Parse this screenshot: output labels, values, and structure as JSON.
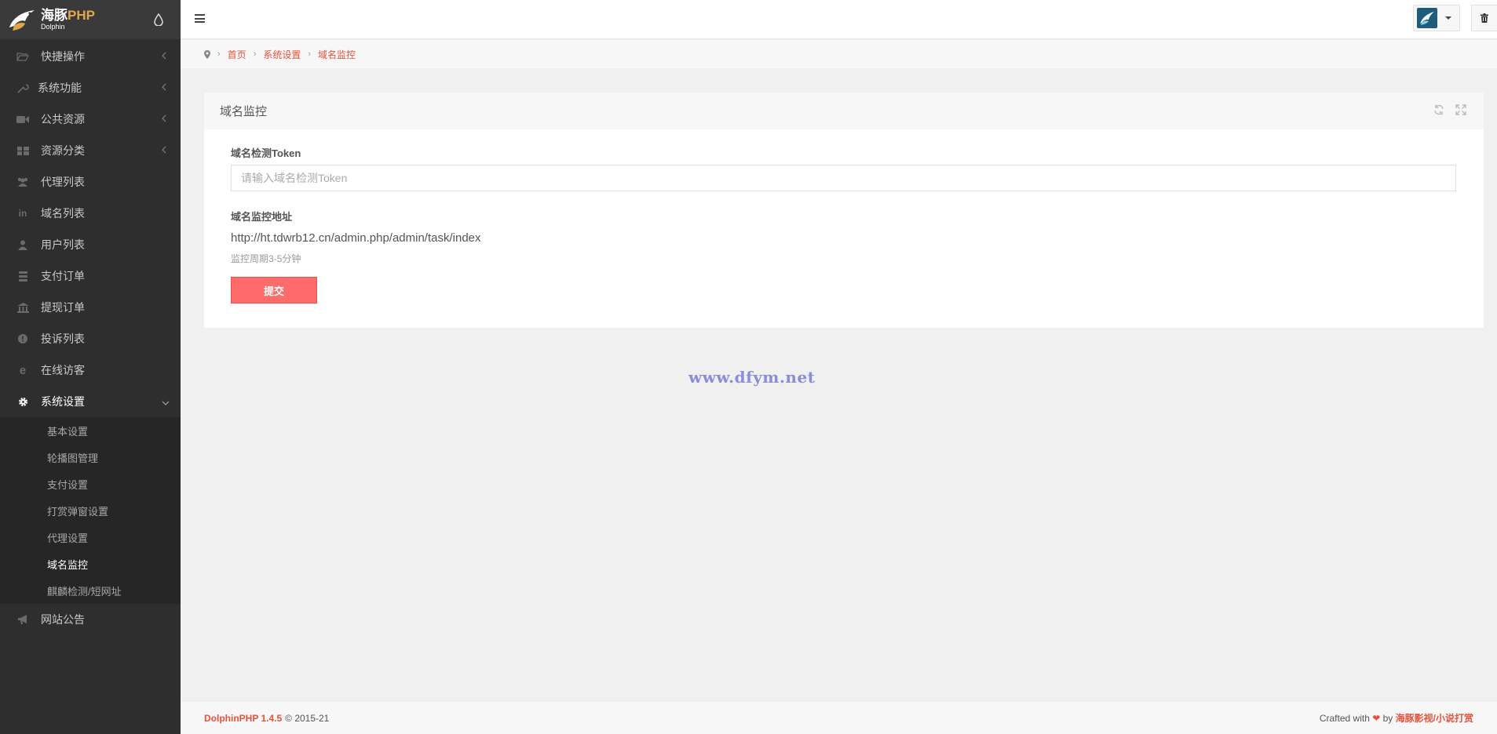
{
  "logo": {
    "name_cn": "海豚",
    "name_php": "PHP",
    "sub": "Dolphin"
  },
  "topbar": {
    "user_avatar_icon": "dolphin-logo-icon",
    "trash_icon": "trash-icon"
  },
  "sidebar": {
    "items": [
      {
        "label": "快捷操作",
        "icon": "folder-open-icon",
        "chevron": "<"
      },
      {
        "label": "系统功能",
        "icon": "wrench-icon",
        "chevron": "<"
      },
      {
        "label": "公共资源",
        "icon": "video-camera-icon",
        "chevron": "<"
      },
      {
        "label": "资源分类",
        "icon": "grid-icon",
        "chevron": "<"
      },
      {
        "label": "代理列表",
        "icon": "users-icon"
      },
      {
        "label": "域名列表",
        "icon": "linkedin-icon"
      },
      {
        "label": "用户列表",
        "icon": "user-icon"
      },
      {
        "label": "支付订单",
        "icon": "database-icon"
      },
      {
        "label": "提现订单",
        "icon": "bank-icon"
      },
      {
        "label": "投诉列表",
        "icon": "exclamation-circle-icon"
      },
      {
        "label": "在线访客",
        "icon": "ie-icon"
      },
      {
        "label": "系统设置",
        "icon": "gear-icon",
        "chevron": "v"
      }
    ],
    "sub_items": [
      {
        "label": "基本设置"
      },
      {
        "label": "轮播图管理"
      },
      {
        "label": "支付设置"
      },
      {
        "label": "打赏弹窗设置"
      },
      {
        "label": "代理设置"
      },
      {
        "label": "域名监控",
        "active": true
      },
      {
        "label": "麒麟检测/短网址"
      }
    ],
    "last_item": {
      "label": "网站公告",
      "icon": "bullhorn-icon"
    }
  },
  "breadcrumb": {
    "home": "首页",
    "section": "系统设置",
    "current": "域名监控"
  },
  "panel": {
    "title": "域名监控",
    "token_label": "域名检测Token",
    "token_placeholder": "请输入域名检测Token",
    "token_value": "",
    "url_label": "域名监控地址",
    "url_value": "http://ht.tdwrb12.cn/admin.php/admin/task/index",
    "help_text": "监控周期3-5分钟",
    "submit_label": "提交"
  },
  "watermark": "www.dfym.net",
  "footer": {
    "brand": "DolphinPHP 1.4.5",
    "copyright": "© 2015-21",
    "crafted": "Crafted with",
    "heart": "❤",
    "by": "by",
    "credit": "海豚影视/小说打赏"
  },
  "colors": {
    "accent": "#e6533c",
    "submit_bg": "#ff6b6b",
    "sidebar_bg": "#2e2e2e"
  }
}
